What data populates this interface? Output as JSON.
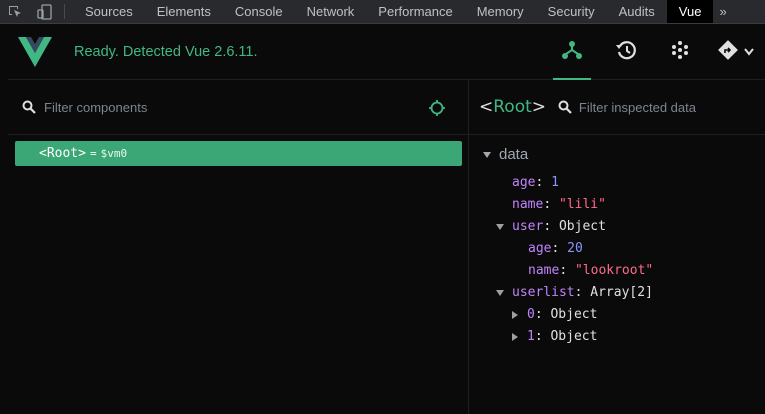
{
  "devtools": {
    "tabs": [
      "Sources",
      "Elements",
      "Console",
      "Network",
      "Performance",
      "Memory",
      "Security",
      "Audits",
      "Vue"
    ],
    "active_tab": "Vue",
    "more": "»"
  },
  "toolbar": {
    "status": "Ready. Detected Vue 2.6.11.",
    "brand_color": "#41b883"
  },
  "components": {
    "filter_placeholder": "Filter components",
    "root_tag": "<Root>",
    "root_eq": "=",
    "root_vm": "$vm0"
  },
  "inspector": {
    "title_open": "<",
    "title_name": "Root",
    "title_close": ">",
    "filter_placeholder": "Filter inspected data",
    "section": "data",
    "rows": [
      {
        "key": "age",
        "value": "1",
        "kind": "num"
      },
      {
        "key": "name",
        "value": "\"lili\"",
        "kind": "str"
      },
      {
        "key": "user",
        "value": "Object",
        "kind": "type"
      },
      {
        "key": "age",
        "value": "20",
        "kind": "num"
      },
      {
        "key": "name",
        "value": "\"lookroot\"",
        "kind": "str"
      },
      {
        "key": "userlist",
        "value": "Array[2]",
        "kind": "type"
      },
      {
        "key": "0",
        "value": "Object",
        "kind": "type"
      },
      {
        "key": "1",
        "value": "Object",
        "kind": "type"
      }
    ]
  }
}
